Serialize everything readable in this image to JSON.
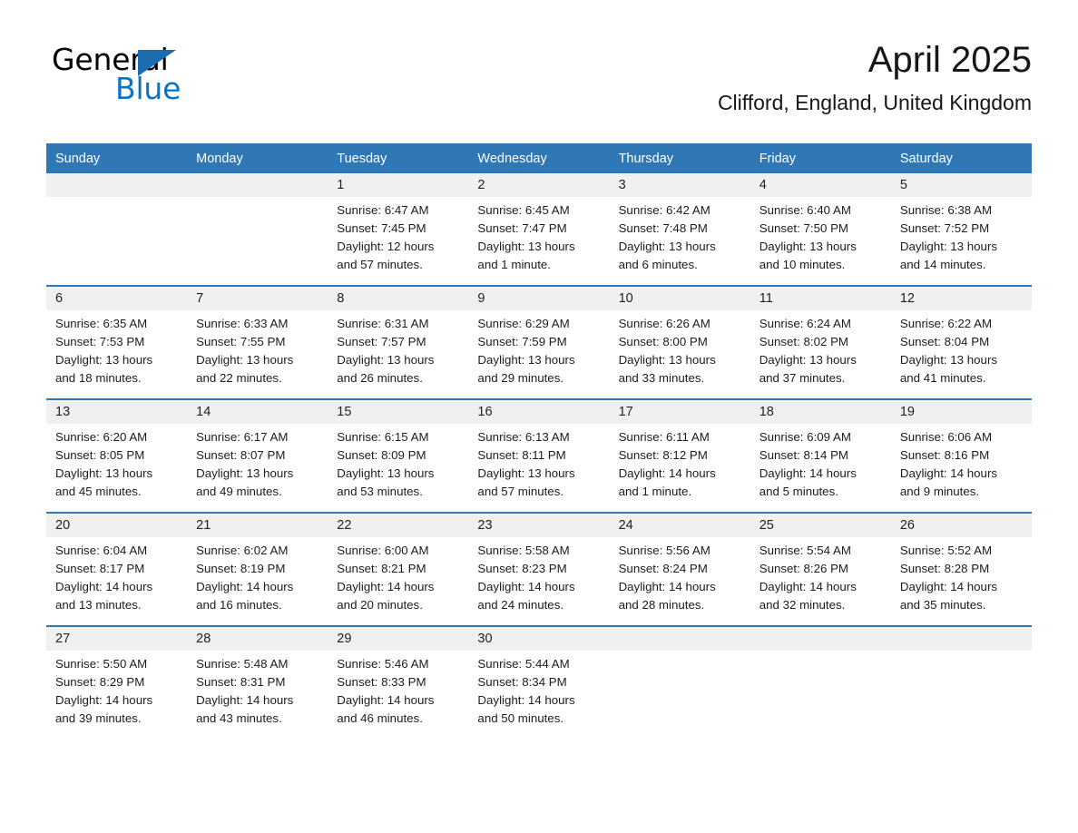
{
  "brand": {
    "name_part1": "General",
    "name_part2": "Blue",
    "accent_color": "#1b6cb0",
    "blue_text_color": "#0b72c4"
  },
  "header": {
    "month_title": "April 2025",
    "location": "Clifford, England, United Kingdom"
  },
  "calendar": {
    "header_bg": "#3077b5",
    "date_band_bg": "#f0f0f0",
    "weekday_headers": [
      "Sunday",
      "Monday",
      "Tuesday",
      "Wednesday",
      "Thursday",
      "Friday",
      "Saturday"
    ],
    "weeks": [
      [
        {
          "day": "",
          "lines": []
        },
        {
          "day": "",
          "lines": []
        },
        {
          "day": "1",
          "lines": [
            "Sunrise: 6:47 AM",
            "Sunset: 7:45 PM",
            "Daylight: 12 hours",
            "and 57 minutes."
          ]
        },
        {
          "day": "2",
          "lines": [
            "Sunrise: 6:45 AM",
            "Sunset: 7:47 PM",
            "Daylight: 13 hours",
            "and 1 minute."
          ]
        },
        {
          "day": "3",
          "lines": [
            "Sunrise: 6:42 AM",
            "Sunset: 7:48 PM",
            "Daylight: 13 hours",
            "and 6 minutes."
          ]
        },
        {
          "day": "4",
          "lines": [
            "Sunrise: 6:40 AM",
            "Sunset: 7:50 PM",
            "Daylight: 13 hours",
            "and 10 minutes."
          ]
        },
        {
          "day": "5",
          "lines": [
            "Sunrise: 6:38 AM",
            "Sunset: 7:52 PM",
            "Daylight: 13 hours",
            "and 14 minutes."
          ]
        }
      ],
      [
        {
          "day": "6",
          "lines": [
            "Sunrise: 6:35 AM",
            "Sunset: 7:53 PM",
            "Daylight: 13 hours",
            "and 18 minutes."
          ]
        },
        {
          "day": "7",
          "lines": [
            "Sunrise: 6:33 AM",
            "Sunset: 7:55 PM",
            "Daylight: 13 hours",
            "and 22 minutes."
          ]
        },
        {
          "day": "8",
          "lines": [
            "Sunrise: 6:31 AM",
            "Sunset: 7:57 PM",
            "Daylight: 13 hours",
            "and 26 minutes."
          ]
        },
        {
          "day": "9",
          "lines": [
            "Sunrise: 6:29 AM",
            "Sunset: 7:59 PM",
            "Daylight: 13 hours",
            "and 29 minutes."
          ]
        },
        {
          "day": "10",
          "lines": [
            "Sunrise: 6:26 AM",
            "Sunset: 8:00 PM",
            "Daylight: 13 hours",
            "and 33 minutes."
          ]
        },
        {
          "day": "11",
          "lines": [
            "Sunrise: 6:24 AM",
            "Sunset: 8:02 PM",
            "Daylight: 13 hours",
            "and 37 minutes."
          ]
        },
        {
          "day": "12",
          "lines": [
            "Sunrise: 6:22 AM",
            "Sunset: 8:04 PM",
            "Daylight: 13 hours",
            "and 41 minutes."
          ]
        }
      ],
      [
        {
          "day": "13",
          "lines": [
            "Sunrise: 6:20 AM",
            "Sunset: 8:05 PM",
            "Daylight: 13 hours",
            "and 45 minutes."
          ]
        },
        {
          "day": "14",
          "lines": [
            "Sunrise: 6:17 AM",
            "Sunset: 8:07 PM",
            "Daylight: 13 hours",
            "and 49 minutes."
          ]
        },
        {
          "day": "15",
          "lines": [
            "Sunrise: 6:15 AM",
            "Sunset: 8:09 PM",
            "Daylight: 13 hours",
            "and 53 minutes."
          ]
        },
        {
          "day": "16",
          "lines": [
            "Sunrise: 6:13 AM",
            "Sunset: 8:11 PM",
            "Daylight: 13 hours",
            "and 57 minutes."
          ]
        },
        {
          "day": "17",
          "lines": [
            "Sunrise: 6:11 AM",
            "Sunset: 8:12 PM",
            "Daylight: 14 hours",
            "and 1 minute."
          ]
        },
        {
          "day": "18",
          "lines": [
            "Sunrise: 6:09 AM",
            "Sunset: 8:14 PM",
            "Daylight: 14 hours",
            "and 5 minutes."
          ]
        },
        {
          "day": "19",
          "lines": [
            "Sunrise: 6:06 AM",
            "Sunset: 8:16 PM",
            "Daylight: 14 hours",
            "and 9 minutes."
          ]
        }
      ],
      [
        {
          "day": "20",
          "lines": [
            "Sunrise: 6:04 AM",
            "Sunset: 8:17 PM",
            "Daylight: 14 hours",
            "and 13 minutes."
          ]
        },
        {
          "day": "21",
          "lines": [
            "Sunrise: 6:02 AM",
            "Sunset: 8:19 PM",
            "Daylight: 14 hours",
            "and 16 minutes."
          ]
        },
        {
          "day": "22",
          "lines": [
            "Sunrise: 6:00 AM",
            "Sunset: 8:21 PM",
            "Daylight: 14 hours",
            "and 20 minutes."
          ]
        },
        {
          "day": "23",
          "lines": [
            "Sunrise: 5:58 AM",
            "Sunset: 8:23 PM",
            "Daylight: 14 hours",
            "and 24 minutes."
          ]
        },
        {
          "day": "24",
          "lines": [
            "Sunrise: 5:56 AM",
            "Sunset: 8:24 PM",
            "Daylight: 14 hours",
            "and 28 minutes."
          ]
        },
        {
          "day": "25",
          "lines": [
            "Sunrise: 5:54 AM",
            "Sunset: 8:26 PM",
            "Daylight: 14 hours",
            "and 32 minutes."
          ]
        },
        {
          "day": "26",
          "lines": [
            "Sunrise: 5:52 AM",
            "Sunset: 8:28 PM",
            "Daylight: 14 hours",
            "and 35 minutes."
          ]
        }
      ],
      [
        {
          "day": "27",
          "lines": [
            "Sunrise: 5:50 AM",
            "Sunset: 8:29 PM",
            "Daylight: 14 hours",
            "and 39 minutes."
          ]
        },
        {
          "day": "28",
          "lines": [
            "Sunrise: 5:48 AM",
            "Sunset: 8:31 PM",
            "Daylight: 14 hours",
            "and 43 minutes."
          ]
        },
        {
          "day": "29",
          "lines": [
            "Sunrise: 5:46 AM",
            "Sunset: 8:33 PM",
            "Daylight: 14 hours",
            "and 46 minutes."
          ]
        },
        {
          "day": "30",
          "lines": [
            "Sunrise: 5:44 AM",
            "Sunset: 8:34 PM",
            "Daylight: 14 hours",
            "and 50 minutes."
          ]
        },
        {
          "day": "",
          "lines": []
        },
        {
          "day": "",
          "lines": []
        },
        {
          "day": "",
          "lines": []
        }
      ]
    ]
  }
}
